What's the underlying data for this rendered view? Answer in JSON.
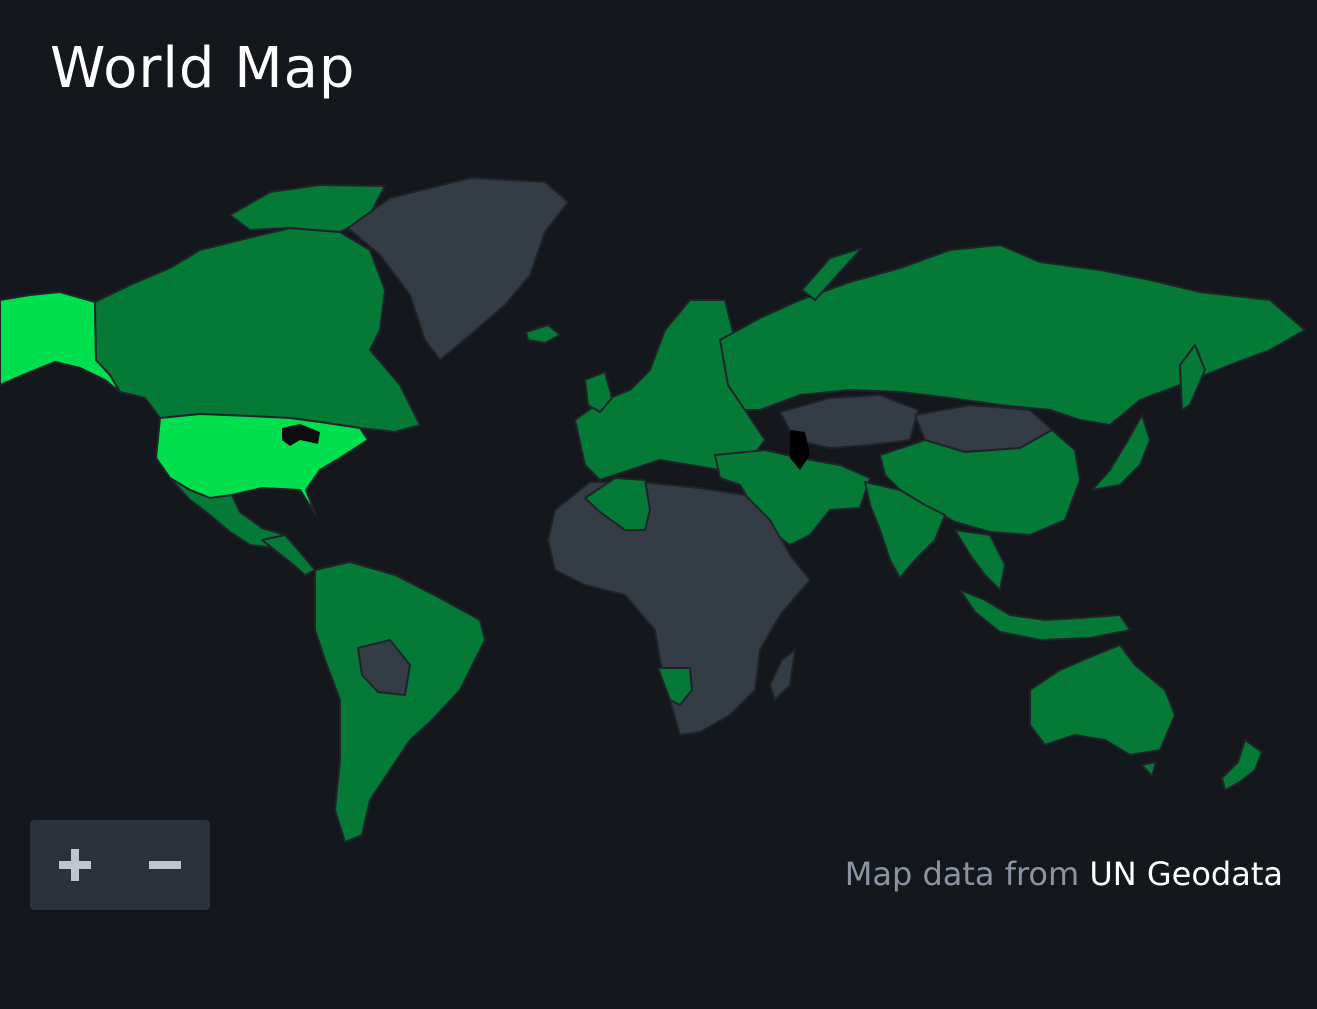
{
  "header": {
    "title": "World Map"
  },
  "colors": {
    "background": "#14171c",
    "no_data": "#343c46",
    "border": "#1f242b",
    "level_1": "#047a36",
    "level_2": "#00e04e",
    "zoom_panel": "#2c323b",
    "zoom_icon": "#bfc5cf"
  },
  "map": {
    "regions": [
      {
        "name": "Alaska",
        "level": "level_2"
      },
      {
        "name": "Canada",
        "level": "level_1"
      },
      {
        "name": "Greenland",
        "level": "no_data"
      },
      {
        "name": "United States",
        "level": "level_2"
      },
      {
        "name": "Mexico",
        "level": "level_1"
      },
      {
        "name": "Central America",
        "level": "level_1"
      },
      {
        "name": "South America",
        "level": "level_1"
      },
      {
        "name": "Bolivia",
        "level": "no_data"
      },
      {
        "name": "Europe",
        "level": "level_1"
      },
      {
        "name": "Russia",
        "level": "level_1"
      },
      {
        "name": "Kazakhstan",
        "level": "no_data"
      },
      {
        "name": "Mongolia",
        "level": "no_data"
      },
      {
        "name": "China",
        "level": "level_1"
      },
      {
        "name": "India",
        "level": "level_1"
      },
      {
        "name": "Middle East",
        "level": "level_1"
      },
      {
        "name": "Africa",
        "level": "no_data"
      },
      {
        "name": "Algeria",
        "level": "level_1"
      },
      {
        "name": "Namibia",
        "level": "level_1"
      },
      {
        "name": "Southeast Asia",
        "level": "level_1"
      },
      {
        "name": "Japan",
        "level": "level_1"
      },
      {
        "name": "Australia",
        "level": "level_1"
      },
      {
        "name": "New Zealand",
        "level": "level_1"
      }
    ]
  },
  "zoom": {
    "zoom_in_icon": "plus-icon",
    "zoom_out_icon": "minus-icon"
  },
  "attribution": {
    "prefix": "Map data from ",
    "source": "UN Geodata"
  }
}
